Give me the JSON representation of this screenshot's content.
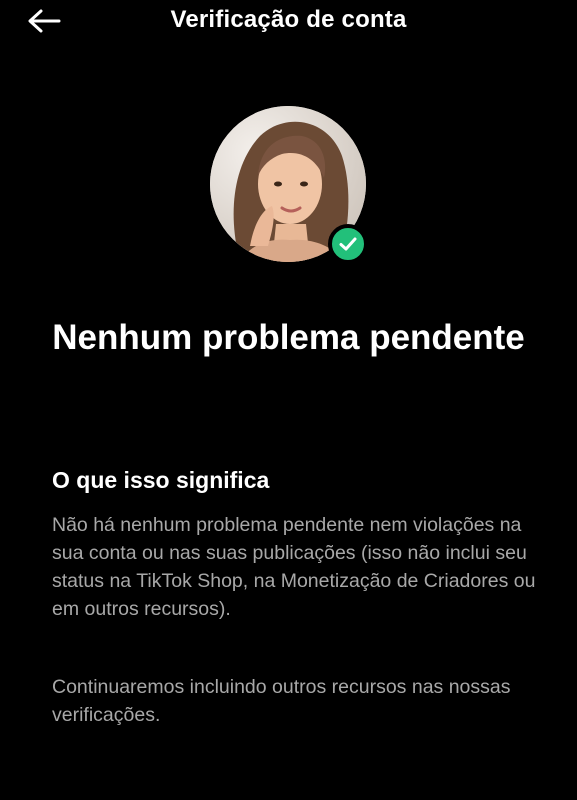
{
  "header": {
    "title": "Verificação de conta",
    "back_icon": "arrow-left-icon"
  },
  "profile": {
    "avatar": "profile-avatar",
    "badge_icon": "verified-check-icon",
    "badge_color": "#22c07a"
  },
  "status": {
    "title": "Nenhum problema pendente"
  },
  "info": {
    "heading": "O que isso significa",
    "paragraph_1": "Não há nenhum problema pendente nem violações na sua conta ou nas suas publicações (isso não inclui seu status na TikTok Shop, na Monetização de Criadores ou em outros recursos).",
    "paragraph_2": "Continuaremos incluindo outros recursos nas nossas verificações."
  }
}
